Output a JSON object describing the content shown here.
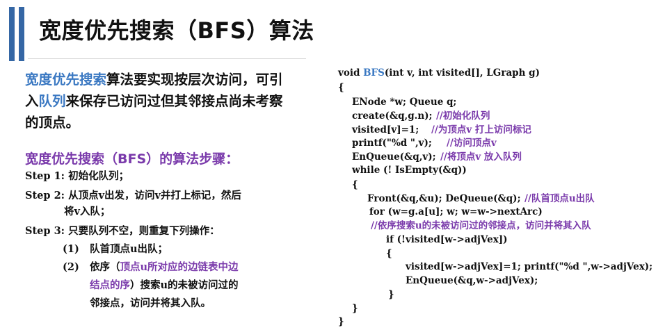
{
  "title": "宽度优先搜索（BFS）算法",
  "intro": {
    "line1": {
      "hl": "宽度优先搜索",
      "rest": "算法要实现按层次访问，可引"
    },
    "line2": {
      "pre": "入",
      "hl": "队列",
      "rest": "来保存已访问过但其邻接点尚未考察"
    },
    "line3": "的顶点。"
  },
  "steps_heading": "宽度优先搜索（BFS）的算法步骤：",
  "steps": {
    "s1": "Step 1: 初始化队列；",
    "s2a": "Step 2: 从顶点v出发，访问v并打上标记，然后",
    "s2b": "将v入队；",
    "s3": "Step 3: 只要队列不空，则重复下列操作：",
    "sub1_num": "(1)",
    "sub1_text": "队首顶点u出队；",
    "sub2_num": "(2)",
    "sub2_pre": "依序（",
    "sub2_hl_a": "顶点u所对应的边链表中边",
    "sub2_hl_b": "结点的序",
    "sub2_rest_b": "）搜索u的未被访问过的",
    "sub2_c": "邻接点，访问并将其入队。"
  },
  "code": {
    "l1_pre": "void ",
    "l1_fn": "BFS",
    "l1_rest": "(int v, int visited[], LGraph g)",
    "l2": "{",
    "l3": "ENode *w;  Queue q;",
    "l4_code": "create(&q,g.n);",
    "l4_cm": "//初始化队列",
    "l5_code": "visited[v]=1;",
    "l5_cm": "//为顶点v 打上访问标记",
    "l6_code": "printf(\"%d \",v);",
    "l6_cm": "//访问顶点v",
    "l7_code": "EnQueue(&q,v);",
    "l7_cm": "//将顶点v 放入队列",
    "l8": "while (! IsEmpty(&q))",
    "l9": "{",
    "l10_code": "Front(&q,&u);   DeQueue(&q);",
    "l10_cm": "//队首顶点u出队",
    "l11": "for (w=g.a[u]; w; w=w->nextArc)",
    "l12_cm": "//依序搜索u的未被访问过的邻接点，访问并将其入队",
    "l13": "if (!visited[w->adjVex])",
    "l14": "{",
    "l15": "visited[w->adjVex]=1;  printf(\"%d \",w->adjVex);",
    "l16": "EnQueue(&q,w->adjVex);",
    "l17": "}",
    "l18": "}",
    "l19": "}"
  },
  "colors": {
    "accent": "#3567a5",
    "blue_text": "#3a78c2",
    "purple_text": "#7a3aab"
  }
}
